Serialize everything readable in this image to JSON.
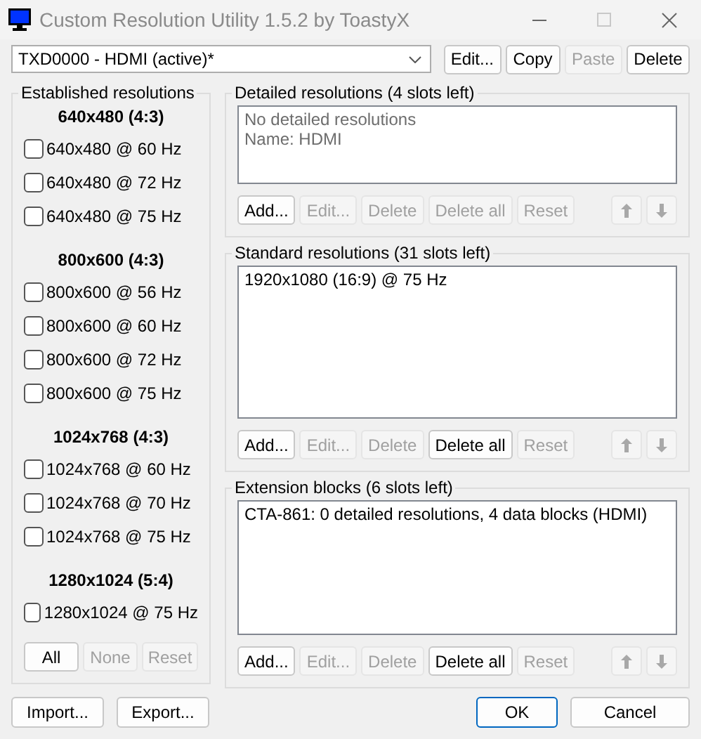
{
  "window": {
    "title": "Custom Resolution Utility 1.5.2 by ToastyX",
    "maximize_disabled": true
  },
  "device": {
    "value": "TXD0000 - HDMI (active)*"
  },
  "device_buttons": [
    {
      "label": "Edit...",
      "disabled": false
    },
    {
      "label": "Copy",
      "disabled": false
    },
    {
      "label": "Paste",
      "disabled": true
    },
    {
      "label": "Delete",
      "disabled": false
    }
  ],
  "established": {
    "title": "Established resolutions",
    "groups": [
      {
        "heading": "640x480 (4:3)",
        "items": [
          {
            "label": "640x480 @ 60 Hz",
            "checked": false
          },
          {
            "label": "640x480 @ 72 Hz",
            "checked": false
          },
          {
            "label": "640x480 @ 75 Hz",
            "checked": false
          }
        ]
      },
      {
        "heading": "800x600 (4:3)",
        "items": [
          {
            "label": "800x600 @ 56 Hz",
            "checked": false
          },
          {
            "label": "800x600 @ 60 Hz",
            "checked": false
          },
          {
            "label": "800x600 @ 72 Hz",
            "checked": false
          },
          {
            "label": "800x600 @ 75 Hz",
            "checked": false
          }
        ]
      },
      {
        "heading": "1024x768 (4:3)",
        "items": [
          {
            "label": "1024x768 @ 60 Hz",
            "checked": false
          },
          {
            "label": "1024x768 @ 70 Hz",
            "checked": false
          },
          {
            "label": "1024x768 @ 75 Hz",
            "checked": false
          }
        ]
      },
      {
        "heading": "1280x1024 (5:4)",
        "items": [
          {
            "label": "1280x1024 @ 75 Hz",
            "checked": false
          }
        ]
      }
    ],
    "buttons": [
      {
        "label": "All",
        "disabled": false
      },
      {
        "label": "None",
        "disabled": true
      },
      {
        "label": "Reset",
        "disabled": true
      }
    ]
  },
  "panels": [
    {
      "title": "Detailed resolutions (4 slots left)",
      "entries": [
        {
          "text": "No detailed resolutions",
          "kind": "note"
        },
        {
          "text": "Name: HDMI",
          "kind": "note"
        }
      ],
      "buttons": [
        {
          "label": "Add...",
          "disabled": false
        },
        {
          "label": "Edit...",
          "disabled": true
        },
        {
          "label": "Delete",
          "disabled": true
        },
        {
          "label": "Delete all",
          "disabled": true
        },
        {
          "label": "Reset",
          "disabled": true
        }
      ],
      "arrows": [
        {
          "kind": "up",
          "disabled": true
        },
        {
          "kind": "down",
          "disabled": true
        }
      ]
    },
    {
      "title": "Standard resolutions (31 slots left)",
      "entries": [
        {
          "text": "1920x1080 (16:9) @ 75 Hz",
          "kind": "entry"
        }
      ],
      "buttons": [
        {
          "label": "Add...",
          "disabled": false
        },
        {
          "label": "Edit...",
          "disabled": true
        },
        {
          "label": "Delete",
          "disabled": true
        },
        {
          "label": "Delete all",
          "disabled": false
        },
        {
          "label": "Reset",
          "disabled": true
        }
      ],
      "arrows": [
        {
          "kind": "up",
          "disabled": true
        },
        {
          "kind": "down",
          "disabled": true
        }
      ]
    },
    {
      "title": "Extension blocks (6 slots left)",
      "entries": [
        {
          "text": "CTA-861: 0 detailed resolutions, 4 data blocks (HDMI)",
          "kind": "entry"
        }
      ],
      "buttons": [
        {
          "label": "Add...",
          "disabled": false
        },
        {
          "label": "Edit...",
          "disabled": true
        },
        {
          "label": "Delete",
          "disabled": true
        },
        {
          "label": "Delete all",
          "disabled": false
        },
        {
          "label": "Reset",
          "disabled": true
        }
      ],
      "arrows": [
        {
          "kind": "up",
          "disabled": true
        },
        {
          "kind": "down",
          "disabled": true
        }
      ]
    }
  ],
  "footer_left": [
    {
      "label": "Import...",
      "default": false
    },
    {
      "label": "Export...",
      "default": false
    }
  ],
  "footer_right": [
    {
      "label": "OK",
      "default": true
    },
    {
      "label": "Cancel",
      "default": false
    }
  ]
}
